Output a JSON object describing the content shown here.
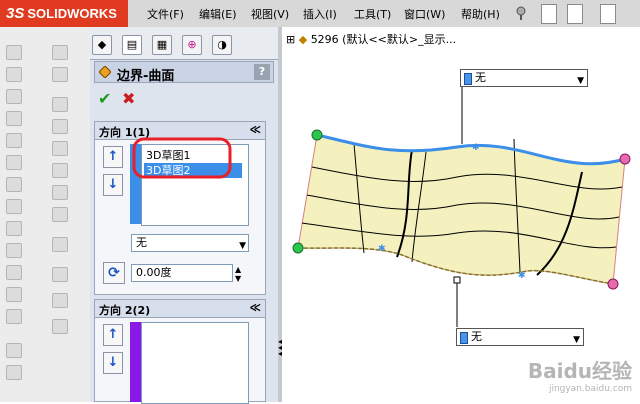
{
  "app": {
    "logo": "SOLIDWORKS"
  },
  "menu": [
    "文件(F)",
    "编辑(E)",
    "视图(V)",
    "插入(I)",
    "工具(T)",
    "窗口(W)",
    "帮助(H)"
  ],
  "pm_tabs": [
    "feature-manager",
    "property-manager",
    "configuration-manager",
    "dimxpert-manager",
    "display-manager"
  ],
  "pm": {
    "title": "边界-曲面",
    "help": "?",
    "ok": "✔",
    "cancel": "✖",
    "direction1": {
      "title": "方向 1(1)",
      "items": [
        "3D草图1",
        "3D草图2"
      ],
      "selected_index": 1,
      "tangency": "无",
      "angle": "0.00度"
    },
    "direction2": {
      "title": "方向 2(2)"
    }
  },
  "graphics": {
    "tree_label": "5296 (默认<<默认>_显示...",
    "callout_top": "无",
    "callout_bottom": "无"
  },
  "watermark": {
    "main": "Baidu经验",
    "sub": "jingyan.baidu.com"
  },
  "colors": {
    "logo_red": "#e03a20",
    "surface_fill": "#f4f1bf",
    "selection_blue": "#3b8fe8",
    "highlight_red": "#e8202a"
  }
}
